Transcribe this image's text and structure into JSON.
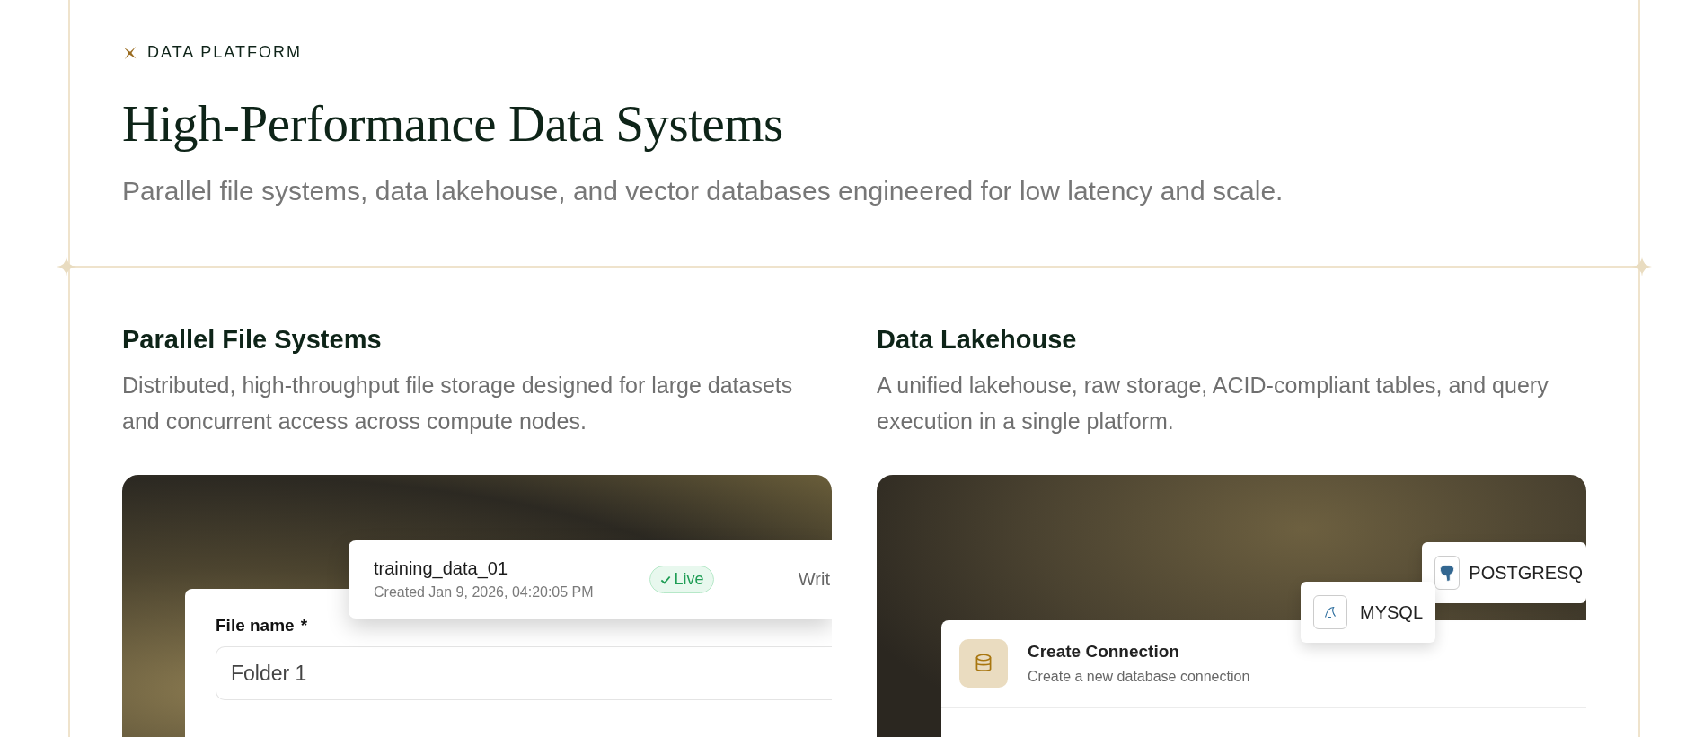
{
  "eyebrow": "DATA PLATFORM",
  "title": "High-Performance Data Systems",
  "subtitle": "Parallel file systems, data lakehouse, and vector databases engineered for low latency and scale.",
  "features": [
    {
      "kind": "files",
      "heading": "Parallel File Systems",
      "description": "Distributed, high-throughput file storage designed for large datasets and concurrent access across compute nodes.",
      "dataset": {
        "name": "training_data_01",
        "created": "Created Jan 9, 2026, 04:20:05 PM",
        "status": "Live",
        "column_3": "Writ"
      },
      "form": {
        "label": "File name",
        "required_mark": "*",
        "value": "Folder 1"
      }
    },
    {
      "kind": "lakehouse",
      "heading": "Data Lakehouse",
      "description": "A unified lakehouse, raw storage, ACID-compliant tables, and query execution in a single platform.",
      "connection": {
        "title": "Create Connection",
        "subtitle": "Create a new database connection"
      },
      "sources": [
        {
          "kind": "mysql",
          "label": "MYSQL"
        },
        {
          "kind": "postgres",
          "label": "POSTGRESQ"
        }
      ]
    }
  ]
}
